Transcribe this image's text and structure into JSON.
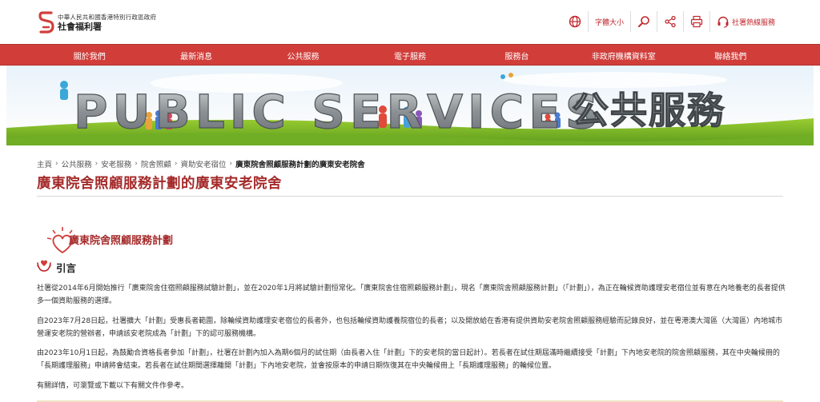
{
  "header": {
    "logo_line1": "中華人民共和國香港特別行政區政府",
    "logo_line2": "社會福利署",
    "tools": {
      "font_size_label": "字體大小",
      "hotline_label": "社署熱線服務"
    }
  },
  "nav": {
    "items": [
      {
        "label": "關於我們"
      },
      {
        "label": "最新消息"
      },
      {
        "label": "公共服務"
      },
      {
        "label": "電子服務"
      },
      {
        "label": "服務台"
      },
      {
        "label": "非政府機構資料室"
      },
      {
        "label": "聯絡我們"
      }
    ]
  },
  "banner": {
    "title_en": "PUBLIC SERVICES",
    "title_zh": "公共服務"
  },
  "breadcrumb": [
    {
      "label": "主頁"
    },
    {
      "label": "公共服務"
    },
    {
      "label": "安老服務"
    },
    {
      "label": "院舍照顧"
    },
    {
      "label": "資助安老宿位"
    },
    {
      "label": "廣東院舍照顧服務計劃的廣東安老院舍"
    }
  ],
  "page_title": "廣東院舍照顧服務計劃的廣東安老院舍",
  "section_title": "廣東院舍照顧服務計劃",
  "intro_label": "引言",
  "paragraphs": [
    "社署從2014年6月開始推行「廣東院舍住宿照顧服務試驗計劃」，並在2020年1月將試驗計劃恒常化。「廣東院舍住宿照顧服務計劃」，現名「廣東院舍照顧服務計劃」（「計劃」），為正在輪候資助護理安老宿位並有意在內地養老的長者提供多一個資助服務的選擇。",
    "自2023年7月28日起，社署擴大「計劃」受惠長者範圍，除輪候資助護理安老宿位的長者外，也包括輪候資助護養院宿位的長者；以及開放給在香港有提供資助安老院舍照顧服務經驗而記錄良好，並在粵港澳大灣區（大灣區）內地城市營運安老院的營辦者，申請該安老院成為「計劃」下的認可服務機構。",
    "由2023年10月1日起，為鼓勵合資格長者參加「計劃」，社署在計劃內加入為期6個月的試住期（由長者入住「計劃」下的安老院的當日起計）。若長者在試住期屆滿時繼續接受「計劃」下內地安老院的院舍照顧服務，其在中央輪候冊的「長期護理服務」申請將會結束。若長者在試住期間選擇離開「計劃」下內地安老院，並會按原本的申請日期恢復其在中央輪候冊上「長期護理服務」的輪候位置。",
    "有關詳情，可瀏覽或下載以下有關文件作參考。"
  ],
  "colors": {
    "brand_red": "#d13e3a",
    "title_red": "#a52a2a",
    "icon_red": "#c0282e"
  },
  "icons": [
    "globe-icon",
    "search-icon",
    "share-icon",
    "print-icon",
    "headset-icon",
    "heart-icon",
    "care-hands-icon"
  ]
}
